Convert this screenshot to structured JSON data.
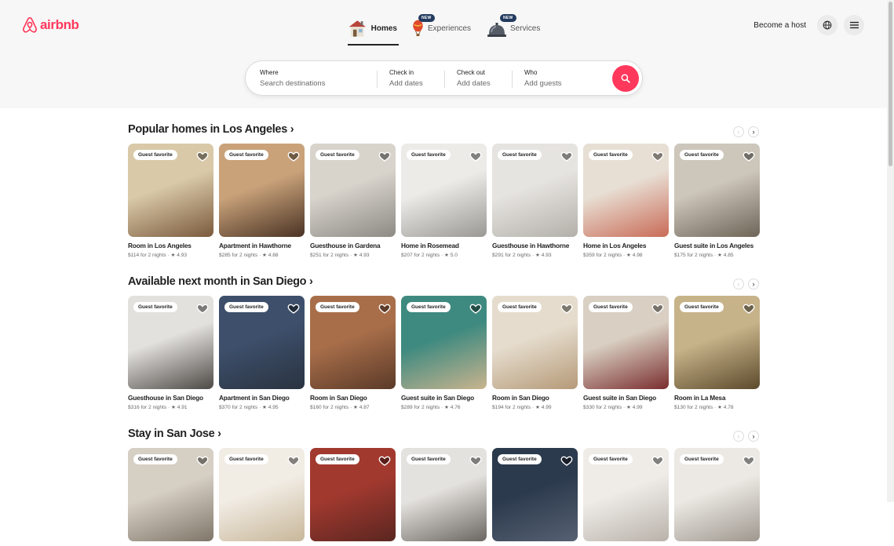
{
  "brand": {
    "name": "airbnb",
    "color": "#ff385c"
  },
  "nav": {
    "tabs": [
      {
        "label": "Homes",
        "icon": "house-icon",
        "active": true
      },
      {
        "label": "Experiences",
        "icon": "hot-air-balloon-icon",
        "badge": "NEW"
      },
      {
        "label": "Services",
        "icon": "service-bell-icon",
        "badge": "NEW"
      }
    ],
    "become_host": "Become a host",
    "globe_icon": "globe-icon",
    "menu_icon": "hamburger-menu-icon"
  },
  "search": {
    "where_label": "Where",
    "where_placeholder": "Search destinations",
    "checkin_label": "Check in",
    "checkin_value": "Add dates",
    "checkout_label": "Check out",
    "checkout_value": "Add dates",
    "who_label": "Who",
    "who_value": "Add guests",
    "button_icon": "magnifier-icon"
  },
  "sections": [
    {
      "title": "Popular homes in Los Angeles ›",
      "cards": [
        {
          "badge": "Guest favorite",
          "title": "Room in Los Angeles",
          "meta": "$114 for 2 nights · ★ 4.93",
          "photo": [
            "#d9c9a8",
            "#7a5a3c"
          ]
        },
        {
          "badge": "Guest favorite",
          "title": "Apartment in Hawthorne",
          "meta": "$285 for 2 nights · ★ 4.88",
          "photo": [
            "#c9a27a",
            "#4a3324"
          ]
        },
        {
          "badge": "Guest favorite",
          "title": "Guesthouse in Gardena",
          "meta": "$251 for 2 nights · ★ 4.93",
          "photo": [
            "#d8d4cc",
            "#8d8a84"
          ]
        },
        {
          "badge": "Guest favorite",
          "title": "Home in Rosemead",
          "meta": "$207 for 2 nights · ★ 5.0",
          "photo": [
            "#ecebe8",
            "#9a9895"
          ]
        },
        {
          "badge": "Guest favorite",
          "title": "Guesthouse in Hawthorne",
          "meta": "$291 for 2 nights · ★ 4.93",
          "photo": [
            "#e6e4e0",
            "#b3b0aa"
          ]
        },
        {
          "badge": "Guest favorite",
          "title": "Home in Los Angeles",
          "meta": "$359 for 2 nights · ★ 4.98",
          "photo": [
            "#e8dfd4",
            "#c96b57"
          ]
        },
        {
          "badge": "Guest favorite",
          "title": "Guest suite in Los Angeles",
          "meta": "$175 for 2 nights · ★ 4.85",
          "photo": [
            "#cdc6bb",
            "#6e6558"
          ]
        }
      ]
    },
    {
      "title": "Available next month in San Diego ›",
      "cards": [
        {
          "badge": "Guest favorite",
          "title": "Guesthouse in San Diego",
          "meta": "$316 for 2 nights · ★ 4.91",
          "photo": [
            "#e3e1dd",
            "#4d4a46"
          ]
        },
        {
          "badge": "Guest favorite",
          "title": "Apartment in San Diego",
          "meta": "$370 for 2 nights · ★ 4.95",
          "photo": [
            "#3d4f6b",
            "#2a3340"
          ]
        },
        {
          "badge": "Guest favorite",
          "title": "Room in San Diego",
          "meta": "$160 for 2 nights · ★ 4.87",
          "photo": [
            "#a86e4a",
            "#5b3a28"
          ]
        },
        {
          "badge": "Guest favorite",
          "title": "Guest suite in San Diego",
          "meta": "$289 for 2 nights · ★ 4.76",
          "photo": [
            "#3f8a80",
            "#c9b48e"
          ]
        },
        {
          "badge": "Guest favorite",
          "title": "Room in San Diego",
          "meta": "$194 for 2 nights · ★ 4.99",
          "photo": [
            "#e5dccd",
            "#b59a78"
          ]
        },
        {
          "badge": "Guest favorite",
          "title": "Guest suite in San Diego",
          "meta": "$330 for 2 nights · ★ 4.99",
          "photo": [
            "#d9cfc2",
            "#7a2e2e"
          ]
        },
        {
          "badge": "Guest favorite",
          "title": "Room in La Mesa",
          "meta": "$130 for 2 nights · ★ 4.78",
          "photo": [
            "#c7b389",
            "#5c4a2c"
          ]
        }
      ]
    },
    {
      "title": "Stay in San Jose ›",
      "cards": [
        {
          "badge": "Guest favorite",
          "title": "",
          "meta": "",
          "photo": [
            "#d6cfc4",
            "#7f7669"
          ]
        },
        {
          "badge": "Guest favorite",
          "title": "",
          "meta": "",
          "photo": [
            "#f1ece4",
            "#c8b79a"
          ]
        },
        {
          "badge": "Guest favorite",
          "title": "",
          "meta": "",
          "photo": [
            "#a2392f",
            "#5a2620"
          ]
        },
        {
          "badge": "Guest favorite",
          "title": "",
          "meta": "",
          "photo": [
            "#e4e2de",
            "#6b6661"
          ]
        },
        {
          "badge": "Guest favorite",
          "title": "",
          "meta": "",
          "photo": [
            "#2c3a4d",
            "#566173"
          ]
        },
        {
          "badge": "Guest favorite",
          "title": "",
          "meta": "",
          "photo": [
            "#efece8",
            "#b9b2aa"
          ]
        },
        {
          "badge": "Guest favorite",
          "title": "",
          "meta": "",
          "photo": [
            "#ece9e4",
            "#9e978e"
          ]
        }
      ]
    }
  ]
}
